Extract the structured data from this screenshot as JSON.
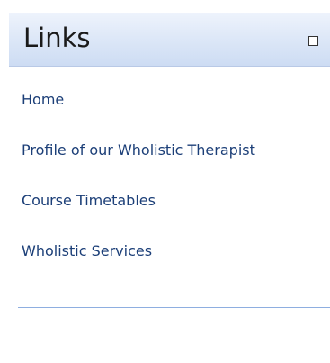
{
  "panel": {
    "title": "Links",
    "collapse_icon": "minus-box-icon",
    "links": [
      {
        "label": "Home"
      },
      {
        "label": "Profile of our Wholistic Therapist"
      },
      {
        "label": "Course Timetables"
      },
      {
        "label": "Wholistic Services"
      }
    ]
  },
  "colors": {
    "link": "#1c3f78",
    "header_gradient_top": "#eef3fc",
    "header_gradient_bottom": "#cddcf3",
    "divider": "#8eaee0"
  }
}
